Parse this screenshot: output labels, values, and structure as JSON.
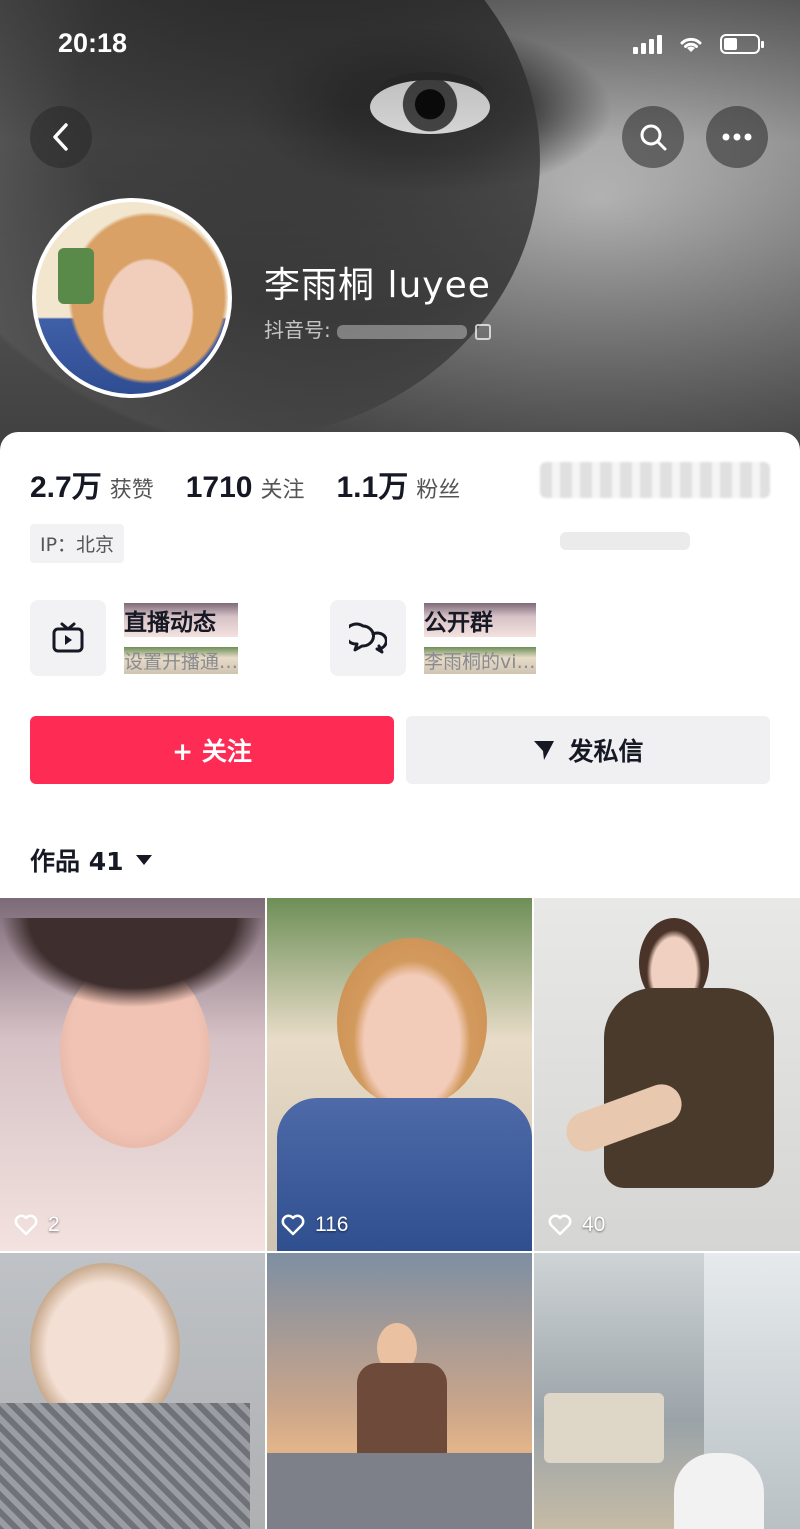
{
  "status_bar": {
    "time": "20:18"
  },
  "profile": {
    "name": "李雨桐 luyee",
    "id_label": "抖音号:",
    "ip_label": "IP：北京"
  },
  "stats": [
    {
      "value": "2.7万",
      "label": "获赞"
    },
    {
      "value": "1710",
      "label": "关注"
    },
    {
      "value": "1.1万",
      "label": "粉丝"
    }
  ],
  "features": {
    "live": {
      "title": "直播动态",
      "subtitle": "设置开播通…",
      "icon": "tv-icon"
    },
    "group": {
      "title": "公开群",
      "subtitle": "李雨桐的vi…",
      "icon": "chat-bubbles-icon"
    }
  },
  "actions": {
    "follow_label": "+ 关注",
    "message_label": "发私信"
  },
  "works": {
    "title": "作品 41",
    "videos": [
      {
        "likes": "2"
      },
      {
        "likes": "116"
      },
      {
        "likes": "40"
      },
      {
        "likes": ""
      },
      {
        "likes": ""
      },
      {
        "likes": ""
      }
    ]
  },
  "colors": {
    "accent": "#fe2c55",
    "button_secondary": "#f0f0f2"
  }
}
